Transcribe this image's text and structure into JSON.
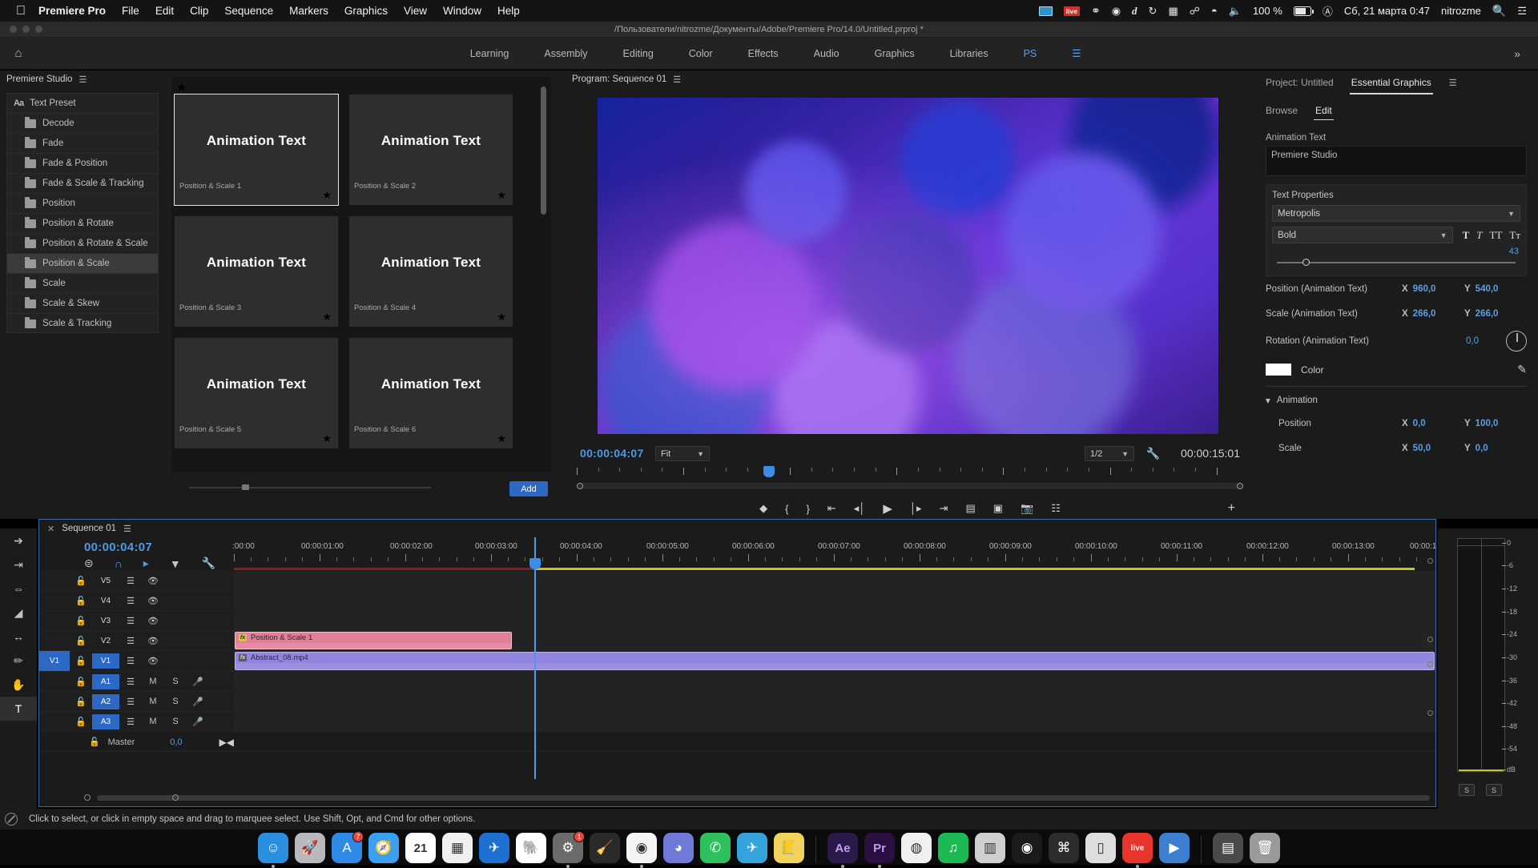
{
  "macbar": {
    "apple_icon": "apple-icon",
    "app_name": "Premiere Pro",
    "menus": [
      "File",
      "Edit",
      "Clip",
      "Sequence",
      "Markers",
      "Graphics",
      "View",
      "Window",
      "Help"
    ],
    "tray": {
      "battery_percent": "100 %",
      "datetime": "Сб, 21 марта  0:47",
      "user": "nitrozme",
      "icons": [
        "display-icon",
        "live-icon",
        "creative-cloud-icon",
        "dropbox-icon",
        "d-icon",
        "timemachine-icon",
        "airplay-icon",
        "bluetooth-icon",
        "wifi-icon",
        "volume-icon",
        "battery-icon",
        "input-source-icon",
        "search-icon",
        "control-center-icon"
      ]
    }
  },
  "titlebar": {
    "project_path": "/Пользователи/nitrozme/Документы/Adobe/Premiere Pro/14.0/Untitled.prproj *"
  },
  "workspace": {
    "home_icon": "home-icon",
    "tabs": [
      "Learning",
      "Assembly",
      "Editing",
      "Color",
      "Effects",
      "Audio",
      "Graphics",
      "Libraries"
    ],
    "custom_tab": "PS",
    "menu_icon": "hamburger-icon",
    "overflow_icon": "chevron-double-right-icon"
  },
  "studio": {
    "title": "Premiere Studio",
    "menu_icon": "hamburger-icon",
    "root": {
      "label": "Text Preset",
      "icon": "text-preset-icon"
    },
    "folders": [
      {
        "label": "Decode",
        "selected": false
      },
      {
        "label": "Fade",
        "selected": false
      },
      {
        "label": "Fade & Position",
        "selected": false
      },
      {
        "label": "Fade & Scale & Tracking",
        "selected": false
      },
      {
        "label": "Position",
        "selected": false
      },
      {
        "label": "Position & Rotate",
        "selected": false
      },
      {
        "label": "Position & Rotate & Scale",
        "selected": false
      },
      {
        "label": "Position & Scale",
        "selected": true
      },
      {
        "label": "Scale",
        "selected": false
      },
      {
        "label": "Scale & Skew",
        "selected": false
      },
      {
        "label": "Scale & Tracking",
        "selected": false
      }
    ]
  },
  "presets": {
    "favorite_icon": "star-icon",
    "preview_text": "Animation Text",
    "cards": [
      {
        "caption": "Position & Scale 1",
        "selected": true
      },
      {
        "caption": "Position & Scale 2",
        "selected": false
      },
      {
        "caption": "Position & Scale 3",
        "selected": false
      },
      {
        "caption": "Position & Scale 4",
        "selected": false
      },
      {
        "caption": "Position & Scale 5",
        "selected": false
      },
      {
        "caption": "Position & Scale 6",
        "selected": false
      }
    ],
    "add_label": "Add"
  },
  "program": {
    "title": "Program: Sequence 01",
    "menu_icon": "hamburger-icon",
    "current_time": "00:00:04:07",
    "fit_value": "Fit",
    "resolution_value": "1/2",
    "settings_icon": "wrench-icon",
    "duration": "00:00:15:01",
    "transport_icons": [
      "mark-in-icon",
      "mark-out-icon",
      "add-marker-icon",
      "go-to-in-icon",
      "step-back-icon",
      "play-icon",
      "step-forward-icon",
      "go-to-out-icon",
      "lift-icon",
      "extract-icon",
      "export-frame-icon",
      "comparison-view-icon",
      "button-editor-icon"
    ]
  },
  "essential_graphics": {
    "tabs": [
      {
        "label": "Project: Untitled",
        "active": false
      },
      {
        "label": "Essential Graphics",
        "active": true
      }
    ],
    "menu_icon": "hamburger-icon",
    "subtabs": [
      {
        "label": "Browse",
        "active": false
      },
      {
        "label": "Edit",
        "active": true
      }
    ],
    "layer_label": "Animation Text",
    "text_value": "Premiere Studio",
    "text_properties": {
      "heading": "Text Properties",
      "font_family": "Metropolis",
      "font_style": "Bold",
      "style_buttons": [
        "faux-bold-icon",
        "faux-italic-icon",
        "all-caps-icon",
        "small-caps-icon"
      ],
      "font_size": "43"
    },
    "properties": [
      {
        "name": "Position (Animation Text)",
        "x_label": "X",
        "x": "960,0",
        "y_label": "Y",
        "y": "540,0"
      },
      {
        "name": "Scale (Animation Text)",
        "x_label": "X",
        "x": "266,0",
        "y_label": "Y",
        "y": "266,0"
      }
    ],
    "rotation": {
      "name": "Rotation (Animation Text)",
      "value": "0,0",
      "dial_icon": "rotation-dial-icon"
    },
    "color": {
      "label": "Color",
      "swatch": "#ffffff",
      "eyedropper_icon": "eyedropper-icon"
    },
    "animation": {
      "label": "Animation",
      "disclosure_icon": "chevron-down-icon",
      "rows": [
        {
          "name": "Position",
          "x_label": "X",
          "x": "0,0",
          "y_label": "Y",
          "y": "100,0"
        },
        {
          "name": "Scale",
          "x_label": "X",
          "x": "50,0",
          "y_label": "Y",
          "y": "0,0"
        }
      ]
    }
  },
  "tools": [
    {
      "icon": "selection-tool-icon",
      "active": false
    },
    {
      "icon": "track-select-forward-icon",
      "active": false
    },
    {
      "icon": "ripple-edit-icon",
      "active": false
    },
    {
      "icon": "razor-tool-icon",
      "active": false
    },
    {
      "icon": "slip-tool-icon",
      "active": false
    },
    {
      "icon": "pen-tool-icon",
      "active": false
    },
    {
      "icon": "hand-tool-icon",
      "active": false
    },
    {
      "icon": "type-tool-icon",
      "active": true
    }
  ],
  "timeline": {
    "close_icon": "close-icon",
    "title": "Sequence 01",
    "menu_icon": "hamburger-icon",
    "playhead_time": "00:00:04:07",
    "toolbar_icons": [
      {
        "icon": "nest-sequence-icon",
        "active": false
      },
      {
        "icon": "snap-icon",
        "active": true
      },
      {
        "icon": "linked-selection-icon",
        "active": true
      },
      {
        "icon": "add-marker-icon",
        "active": false
      },
      {
        "icon": "timeline-settings-icon",
        "active": false
      }
    ],
    "ruler_labels": [
      ":00:00",
      "00:00:01:00",
      "00:00:02:00",
      "00:00:03:00",
      "00:00:04:00",
      "00:00:05:00",
      "00:00:06:00",
      "00:00:07:00",
      "00:00:08:00",
      "00:00:09:00",
      "00:00:10:00",
      "00:00:11:00",
      "00:00:12:00",
      "00:00:13:00",
      "00:00:1"
    ],
    "video_tracks": [
      {
        "name": "V5",
        "targeted": false,
        "lock_icon": "lock-icon",
        "sync_icon": "sync-lock-icon",
        "eye_icon": "eye-icon"
      },
      {
        "name": "V4",
        "targeted": false,
        "lock_icon": "lock-icon",
        "sync_icon": "sync-lock-icon",
        "eye_icon": "eye-icon"
      },
      {
        "name": "V3",
        "targeted": false,
        "lock_icon": "lock-icon",
        "sync_icon": "sync-lock-icon",
        "eye_icon": "eye-icon"
      },
      {
        "name": "V2",
        "targeted": false,
        "lock_icon": "lock-icon",
        "sync_icon": "sync-lock-icon",
        "eye_icon": "eye-icon"
      },
      {
        "name": "V1",
        "targeted": true,
        "lock_icon": "lock-icon",
        "sync_icon": "sync-lock-icon",
        "eye_icon": "eye-icon"
      }
    ],
    "audio_tracks": [
      {
        "name": "A1",
        "targeted": true,
        "mute": "M",
        "solo": "S",
        "mic_icon": "microphone-icon"
      },
      {
        "name": "A2",
        "targeted": true,
        "mute": "M",
        "solo": "S",
        "mic_icon": "microphone-icon"
      },
      {
        "name": "A3",
        "targeted": true,
        "mute": "M",
        "solo": "S",
        "mic_icon": "microphone-icon"
      }
    ],
    "master": {
      "label": "Master",
      "value": "0,0",
      "pan_icon": "pan-icon",
      "lock_icon": "lock-icon"
    },
    "clips": [
      {
        "name": "Position & Scale 1",
        "track": "V2",
        "color": "pink",
        "fx_badge": "fx"
      },
      {
        "name": "Abstract_08.mp4",
        "track": "V1",
        "color": "purple",
        "fx_badge": "fx"
      }
    ]
  },
  "meters": {
    "scale_labels": [
      "0",
      "-6",
      "-12",
      "-18",
      "-24",
      "-30",
      "-36",
      "-42",
      "-48",
      "-54",
      "dB"
    ],
    "solo_buttons": [
      "S",
      "S"
    ]
  },
  "statusbar": {
    "tool_icon": "no-drop-icon",
    "tip": "Click to select, or click in empty space and drag to marquee select. Use Shift, Opt, and Cmd for other options."
  },
  "dock": {
    "items": [
      {
        "name": "finder",
        "glyph": "☺",
        "bg": "#2b8fe0",
        "badge": null,
        "running": true
      },
      {
        "name": "launchpad",
        "glyph": "🚀",
        "bg": "#b9b9bd",
        "badge": null,
        "running": false
      },
      {
        "name": "app-store",
        "glyph": "A",
        "bg": "#2e8ae6",
        "badge": "7",
        "running": false
      },
      {
        "name": "safari",
        "glyph": "🧭",
        "bg": "#3aa0ef",
        "badge": null,
        "running": false
      },
      {
        "name": "calendar",
        "glyph": "21",
        "bg": "#ffffff",
        "badge": null,
        "running": false
      },
      {
        "name": "numbers",
        "glyph": "▦",
        "bg": "#f0f0f0",
        "badge": null,
        "running": false
      },
      {
        "name": "sparkmail",
        "glyph": "✈",
        "bg": "#1d6fd0",
        "badge": null,
        "running": false
      },
      {
        "name": "evernote",
        "glyph": "🐘",
        "bg": "#ffffff",
        "badge": null,
        "running": false
      },
      {
        "name": "system-preferences",
        "glyph": "⚙",
        "bg": "#6b6b6b",
        "badge": "1",
        "running": true
      },
      {
        "name": "cleanmymac",
        "glyph": "🧹",
        "bg": "#2a2a2a",
        "badge": null,
        "running": false
      },
      {
        "name": "chrome",
        "glyph": "◉",
        "bg": "#f5f5f5",
        "badge": null,
        "running": true
      },
      {
        "name": "discord",
        "glyph": "◕",
        "bg": "#6f79d8",
        "badge": null,
        "running": false
      },
      {
        "name": "whatsapp",
        "glyph": "✆",
        "bg": "#2ec05c",
        "badge": null,
        "running": false
      },
      {
        "name": "telegram",
        "glyph": "✈",
        "bg": "#35a4dd",
        "badge": null,
        "running": false
      },
      {
        "name": "notes",
        "glyph": "📒",
        "bg": "#f2d35a",
        "badge": null,
        "running": false
      },
      {
        "name": "after-effects",
        "glyph": "Ae",
        "bg": "#2a1a4a",
        "badge": null,
        "running": true
      },
      {
        "name": "premiere-pro",
        "glyph": "Pr",
        "bg": "#2a1040",
        "badge": null,
        "running": true
      },
      {
        "name": "photoshop-express",
        "glyph": "◍",
        "bg": "#f0f0f0",
        "badge": null,
        "running": false
      },
      {
        "name": "spotify",
        "glyph": "♫",
        "bg": "#1db954",
        "badge": null,
        "running": false
      },
      {
        "name": "jar",
        "glyph": "▥",
        "bg": "#cfcfcf",
        "badge": null,
        "running": false
      },
      {
        "name": "vinyl",
        "glyph": "◉",
        "bg": "#1a1a1a",
        "badge": null,
        "running": false
      },
      {
        "name": "keyboard-maestro",
        "glyph": "⌘",
        "bg": "#2b2b2b",
        "badge": null,
        "running": false
      },
      {
        "name": "iphone-mirror",
        "glyph": "▯",
        "bg": "#dedede",
        "badge": null,
        "running": false
      },
      {
        "name": "ableton-live",
        "glyph": "live",
        "bg": "#e8352b",
        "badge": null,
        "running": true
      },
      {
        "name": "screenflow",
        "glyph": "▶",
        "bg": "#3c7fd0",
        "badge": null,
        "running": false
      },
      {
        "name": "downloads",
        "glyph": "▤",
        "bg": "#4a4a4a",
        "badge": null,
        "running": false
      },
      {
        "name": "trash",
        "glyph": "🗑",
        "bg": "#9a9a9a",
        "badge": null,
        "running": false
      }
    ]
  }
}
